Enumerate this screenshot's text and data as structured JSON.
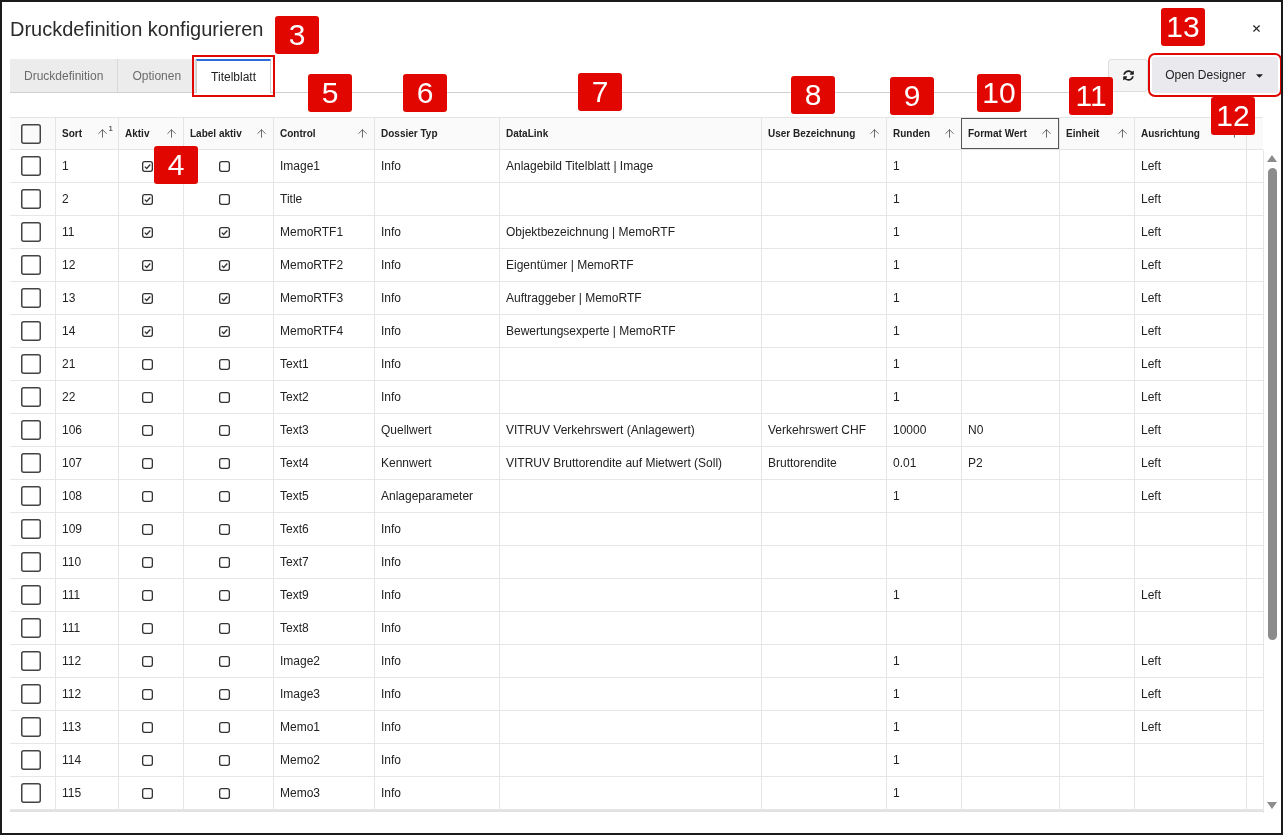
{
  "dialog": {
    "title": "Druckdefinition konfigurieren"
  },
  "tabs": [
    {
      "label": "Druckdefinition",
      "selected": false,
      "highlighted": false
    },
    {
      "label": "Optionen",
      "selected": false,
      "highlighted": false
    },
    {
      "label": "Titelblatt",
      "selected": true,
      "highlighted": true
    }
  ],
  "toolbar": {
    "open_designer": {
      "label": "Open Designer",
      "highlighted": true
    }
  },
  "table": {
    "select_all_checked": false,
    "columns": [
      {
        "label": "Sort",
        "kind": "text",
        "sortable": true,
        "sort_index": "1",
        "focused": false
      },
      {
        "label": "Aktiv",
        "kind": "checkbox",
        "sortable": true,
        "focused": false
      },
      {
        "label": "Label aktiv",
        "kind": "checkbox",
        "sortable": true,
        "focused": false
      },
      {
        "label": "Control",
        "kind": "text",
        "sortable": true,
        "focused": false
      },
      {
        "label": "Dossier Typ",
        "kind": "text",
        "sortable": false,
        "focused": false
      },
      {
        "label": "DataLink",
        "kind": "text",
        "sortable": false,
        "focused": false
      },
      {
        "label": "User Bezeichnung",
        "kind": "text",
        "sortable": true,
        "focused": false
      },
      {
        "label": "Runden",
        "kind": "text",
        "sortable": true,
        "focused": false
      },
      {
        "label": "Format Wert",
        "kind": "text",
        "sortable": true,
        "focused": true
      },
      {
        "label": "Einheit",
        "kind": "text",
        "sortable": true,
        "focused": false
      },
      {
        "label": "Ausrichtung",
        "kind": "text",
        "sortable": true,
        "focused": false
      }
    ],
    "rows": [
      {
        "selected": false,
        "sort": "1",
        "aktiv": true,
        "label_aktiv": false,
        "control": "Image1",
        "dossier_typ": "Info",
        "datalink": "Anlagebild Titelblatt | Image",
        "runden": "1",
        "ausrichtung": "Left"
      },
      {
        "selected": false,
        "sort": "2",
        "aktiv": true,
        "label_aktiv": false,
        "control": "Title",
        "runden": "1",
        "ausrichtung": "Left"
      },
      {
        "selected": false,
        "sort": "11",
        "aktiv": true,
        "label_aktiv": true,
        "control": "MemoRTF1",
        "dossier_typ": "Info",
        "datalink": "Objektbezeichnung | MemoRTF",
        "runden": "1",
        "ausrichtung": "Left"
      },
      {
        "selected": false,
        "sort": "12",
        "aktiv": true,
        "label_aktiv": true,
        "control": "MemoRTF2",
        "dossier_typ": "Info",
        "datalink": "Eigentümer | MemoRTF",
        "runden": "1",
        "ausrichtung": "Left"
      },
      {
        "selected": false,
        "sort": "13",
        "aktiv": true,
        "label_aktiv": true,
        "control": "MemoRTF3",
        "dossier_typ": "Info",
        "datalink": "Auftraggeber | MemoRTF",
        "runden": "1",
        "ausrichtung": "Left"
      },
      {
        "selected": false,
        "sort": "14",
        "aktiv": true,
        "label_aktiv": true,
        "control": "MemoRTF4",
        "dossier_typ": "Info",
        "datalink": "Bewertungsexperte | MemoRTF",
        "runden": "1",
        "ausrichtung": "Left"
      },
      {
        "selected": false,
        "sort": "21",
        "aktiv": false,
        "label_aktiv": false,
        "control": "Text1",
        "dossier_typ": "Info",
        "runden": "1",
        "ausrichtung": "Left"
      },
      {
        "selected": false,
        "sort": "22",
        "aktiv": false,
        "label_aktiv": false,
        "control": "Text2",
        "dossier_typ": "Info",
        "runden": "1",
        "ausrichtung": "Left"
      },
      {
        "selected": false,
        "sort": "106",
        "aktiv": false,
        "label_aktiv": false,
        "control": "Text3",
        "dossier_typ": "Quellwert",
        "datalink": "VITRUV Verkehrswert (Anlagewert)",
        "user_bezeichnung": "Verkehrswert CHF",
        "runden": "10000",
        "format_wert": "N0",
        "ausrichtung": "Left"
      },
      {
        "selected": false,
        "sort": "107",
        "aktiv": false,
        "label_aktiv": false,
        "control": "Text4",
        "dossier_typ": "Kennwert",
        "datalink": "VITRUV Bruttorendite auf Mietwert (Soll)",
        "user_bezeichnung": "Bruttorendite",
        "runden": "0.01",
        "format_wert": "P2",
        "ausrichtung": "Left"
      },
      {
        "selected": false,
        "sort": "108",
        "aktiv": false,
        "label_aktiv": false,
        "control": "Text5",
        "dossier_typ": "Anlageparameter",
        "runden": "1",
        "ausrichtung": "Left"
      },
      {
        "selected": false,
        "sort": "109",
        "aktiv": false,
        "label_aktiv": false,
        "control": "Text6",
        "dossier_typ": "Info"
      },
      {
        "selected": false,
        "sort": "110",
        "aktiv": false,
        "label_aktiv": false,
        "control": "Text7",
        "dossier_typ": "Info"
      },
      {
        "selected": false,
        "sort": "111",
        "aktiv": false,
        "label_aktiv": false,
        "control": "Text9",
        "dossier_typ": "Info",
        "runden": "1",
        "ausrichtung": "Left"
      },
      {
        "selected": false,
        "sort": "111",
        "aktiv": false,
        "label_aktiv": false,
        "control": "Text8",
        "dossier_typ": "Info"
      },
      {
        "selected": false,
        "sort": "112",
        "aktiv": false,
        "label_aktiv": false,
        "control": "Image2",
        "dossier_typ": "Info",
        "runden": "1",
        "ausrichtung": "Left"
      },
      {
        "selected": false,
        "sort": "112",
        "aktiv": false,
        "label_aktiv": false,
        "control": "Image3",
        "dossier_typ": "Info",
        "runden": "1",
        "ausrichtung": "Left"
      },
      {
        "selected": false,
        "sort": "113",
        "aktiv": false,
        "label_aktiv": false,
        "control": "Memo1",
        "dossier_typ": "Info",
        "runden": "1",
        "ausrichtung": "Left"
      },
      {
        "selected": false,
        "sort": "114",
        "aktiv": false,
        "label_aktiv": false,
        "control": "Memo2",
        "dossier_typ": "Info",
        "runden": "1"
      },
      {
        "selected": false,
        "sort": "115",
        "aktiv": false,
        "label_aktiv": false,
        "control": "Memo3",
        "dossier_typ": "Info",
        "runden": "1"
      }
    ]
  },
  "annotations": [
    {
      "label": "3"
    },
    {
      "label": "4"
    },
    {
      "label": "5"
    },
    {
      "label": "6"
    },
    {
      "label": "7"
    },
    {
      "label": "8"
    },
    {
      "label": "9"
    },
    {
      "label": "10"
    },
    {
      "label": "11"
    },
    {
      "label": "12"
    },
    {
      "label": "13"
    }
  ]
}
